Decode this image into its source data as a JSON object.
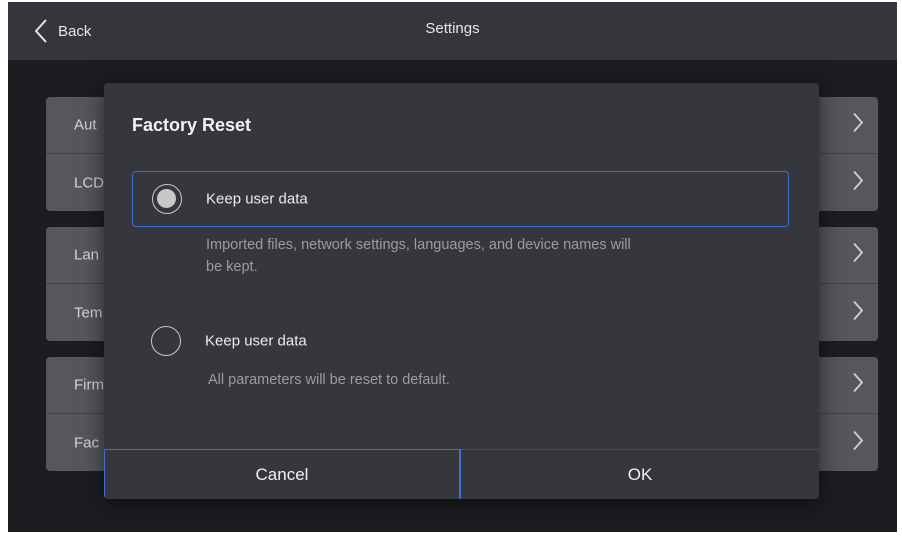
{
  "topbar": {
    "back_label": "Back",
    "title": "Settings"
  },
  "background_list": {
    "groups": [
      {
        "rows": [
          {
            "label": "Aut"
          },
          {
            "label": "LCD"
          }
        ]
      },
      {
        "rows": [
          {
            "label": "Lan"
          },
          {
            "label": "Tem"
          }
        ]
      },
      {
        "rows": [
          {
            "label": "Firm"
          },
          {
            "label": "Fac"
          }
        ]
      }
    ]
  },
  "dialog": {
    "title": "Factory Reset",
    "options": [
      {
        "label": "Keep user data",
        "description_line1": "Imported files, network settings, languages, and device names will",
        "description_line2": "be kept.",
        "selected": true
      },
      {
        "label": "Keep user data",
        "description_line1": "All parameters will be reset to default.",
        "selected": false
      }
    ],
    "cancel_label": "Cancel",
    "ok_label": "OK"
  },
  "colors": {
    "accent": "#3f6fd0",
    "topbar": "#34363c",
    "dialog": "#35373c",
    "backdrop": "#1c1d21"
  },
  "icons": {
    "back": "chevron-left-icon",
    "row": "chevron-right-icon",
    "radio_on": "radio-selected-icon",
    "radio_off": "radio-unselected-icon"
  }
}
